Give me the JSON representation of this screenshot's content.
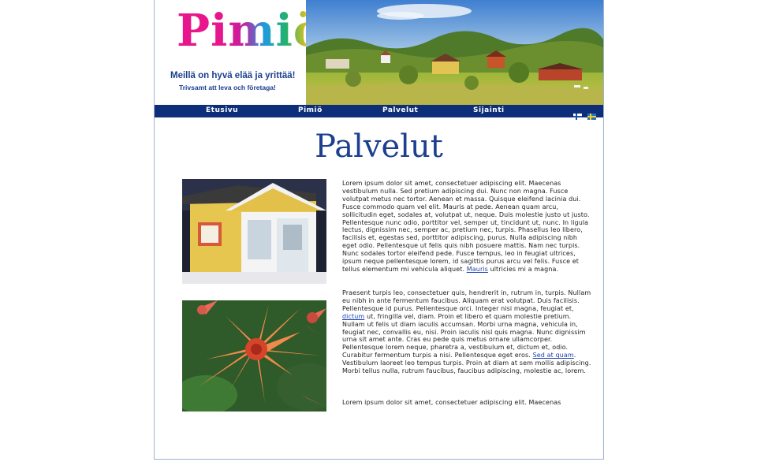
{
  "logo": {
    "name": "Pimiö",
    "slogan_fi": "Meillä on hyvä elää ja yrittää!",
    "slogan_sv": "Trivsamt att leva och företaga!"
  },
  "nav": {
    "items": [
      {
        "label": "Etusivu"
      },
      {
        "label": "Pimiö"
      },
      {
        "label": "Palvelut"
      },
      {
        "label": "Sijainti"
      }
    ],
    "flags": [
      {
        "icon": "finnish-flag-icon"
      },
      {
        "icon": "swedish-flag-icon"
      }
    ]
  },
  "page": {
    "title": "Palvelut"
  },
  "content": {
    "p1": {
      "before_link": "Lorem ipsum dolor sit amet, consectetuer adipiscing elit. Maecenas vestibulum nulla. Sed pretium adipiscing dui. Nunc non magna. Fusce volutpat metus nec tortor. Aenean et massa. Quisque eleifend lacinia dui. Fusce commodo quam vel elit. Mauris at pede. Aenean quam arcu, sollicitudin eget, sodales at, volutpat ut, neque. Duis molestie justo ut justo. Pellentesque nunc odio, porttitor vel, semper ut, tincidunt ut, nunc. In ligula lectus, dignissim nec, semper ac, pretium nec, turpis. Phasellus leo libero, facilisis et, egestas sed, porttitor adipiscing, purus. Nulla adipiscing nibh eget odio. Pellentesque ut felis quis nibh posuere mattis. Nam nec turpis. Nunc sodales tortor eleifend pede. Fusce tempus, leo in feugiat ultrices, ipsum neque pellentesque lorem, id sagittis purus arcu vel felis. Fusce et tellus elementum mi vehicula aliquet. ",
      "link": "Mauris",
      "after_link": " ultricies mi a magna."
    },
    "p2": {
      "part1": "Praesent turpis leo, consectetuer quis, hendrerit in, rutrum in, turpis. Nullam eu nibh in ante fermentum faucibus. Aliquam erat volutpat. Duis facilisis. Pellentesque id purus. Pellentesque orci. Integer nisi magna, feugiat et, ",
      "link1": "dictum",
      "part2": " ut, fringilla vel, diam. Proin et libero et quam molestie pretium. Nullam ut felis ut diam iaculis accumsan. Morbi urna magna, vehicula in, feugiat nec, convallis eu, nisi. Proin iaculis nisl quis magna. Nunc dignissim urna sit amet ante. Cras eu pede quis metus ornare ullamcorper. Pellentesque lorem neque, pharetra a, vestibulum et, dictum et, odio. Curabitur fermentum turpis a nisi. Pellentesque eget eros. ",
      "link2": "Sed at quam",
      "part3": ". Vestibulum laoreet leo tempus turpis. Proin at diam at sem mollis adipiscing. Morbi tellus nulla, rutrum faucibus, faucibus adipiscing, molestie ac, lorem."
    },
    "p3": "Lorem ipsum dolor sit amet, consectetuer adipiscing elit. Maecenas"
  },
  "colors": {
    "nav_bg": "#0d2f7a",
    "title": "#1c3f8f",
    "link": "#1a3fb0"
  }
}
